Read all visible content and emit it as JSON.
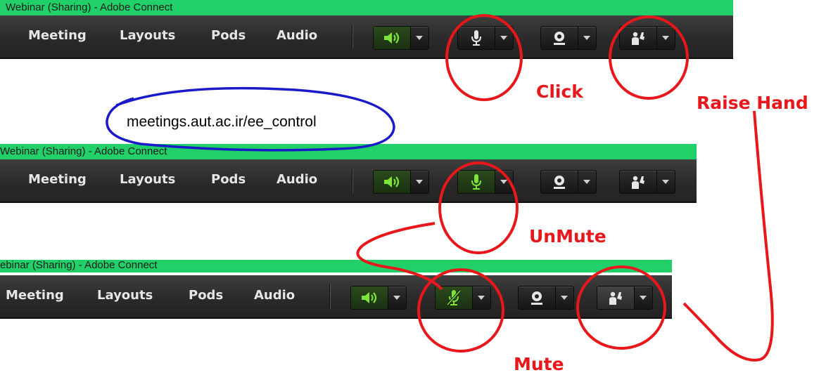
{
  "panels": [
    {
      "title": "Webinar (Sharing) - Adobe Connect",
      "menu": [
        "Meeting",
        "Layouts",
        "Pods",
        "Audio"
      ],
      "mic_state": "idle"
    },
    {
      "title": "Webinar (Sharing) - Adobe Connect",
      "menu": [
        "Meeting",
        "Layouts",
        "Pods",
        "Audio"
      ],
      "mic_state": "on"
    },
    {
      "title": "ebinar (Sharing) - Adobe Connect",
      "menu": [
        "Meeting",
        "Layouts",
        "Pods",
        "Audio"
      ],
      "mic_state": "muted"
    }
  ],
  "url_text": "meetings.aut.ac.ir/ee_control",
  "annotations": {
    "click": "Click",
    "raise_hand": "Raise Hand",
    "unmute": "UnMute",
    "mute": "Mute"
  },
  "colors": {
    "titlebar": "#22d06a",
    "speaker_green": "#7ee43a",
    "annotation_red": "#e8171b",
    "url_circle_blue": "#1a1ac8"
  },
  "icons": [
    "speaker-icon",
    "microphone-icon",
    "webcam-icon",
    "raise-hand-icon",
    "chevron-down-icon"
  ]
}
